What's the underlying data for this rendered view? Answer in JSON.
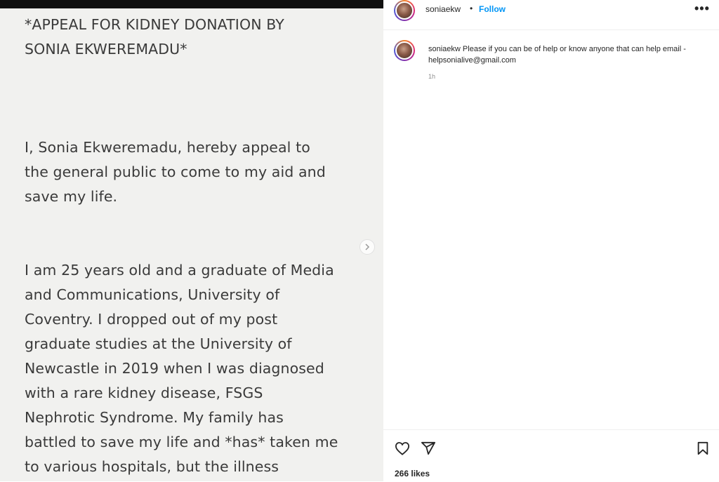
{
  "post_image": {
    "lines_para1": [
      "*APPEAL FOR KIDNEY DONATION BY",
      "SONIA EKWEREMADU*"
    ],
    "lines_para2": [
      "I, Sonia Ekweremadu, hereby appeal to",
      "the general public to come to my aid and",
      "save my life."
    ],
    "lines_para3": [
      "I am 25 years old and a graduate of Media",
      "and Communications, University of",
      "Coventry. I dropped out of my post",
      "graduate studies at the University of",
      "Newcastle in 2019 when I was diagnosed",
      "with a rare kidney disease, FSGS",
      "Nephrotic Syndrome. My family has",
      "battled to save my life and *has* taken me",
      "to various hospitals, but the illness"
    ],
    "next_icon": "chevron-right"
  },
  "header": {
    "username": "soniaekw",
    "separator": "•",
    "follow_label": "Follow",
    "more_icon": "•••"
  },
  "caption": {
    "username": "soniaekw",
    "text": "Please if you can be of help or know anyone that can help email - helpsonialive@gmail.com",
    "time": "1h"
  },
  "actions": {
    "like_icon": "heart-outline",
    "share_icon": "paper-plane",
    "save_icon": "bookmark-outline",
    "likes_text": "266 likes"
  },
  "colors": {
    "link_blue": "#0095f6",
    "text": "#262626",
    "muted": "#8e8e8e",
    "image_bg": "#f1f1ef"
  }
}
